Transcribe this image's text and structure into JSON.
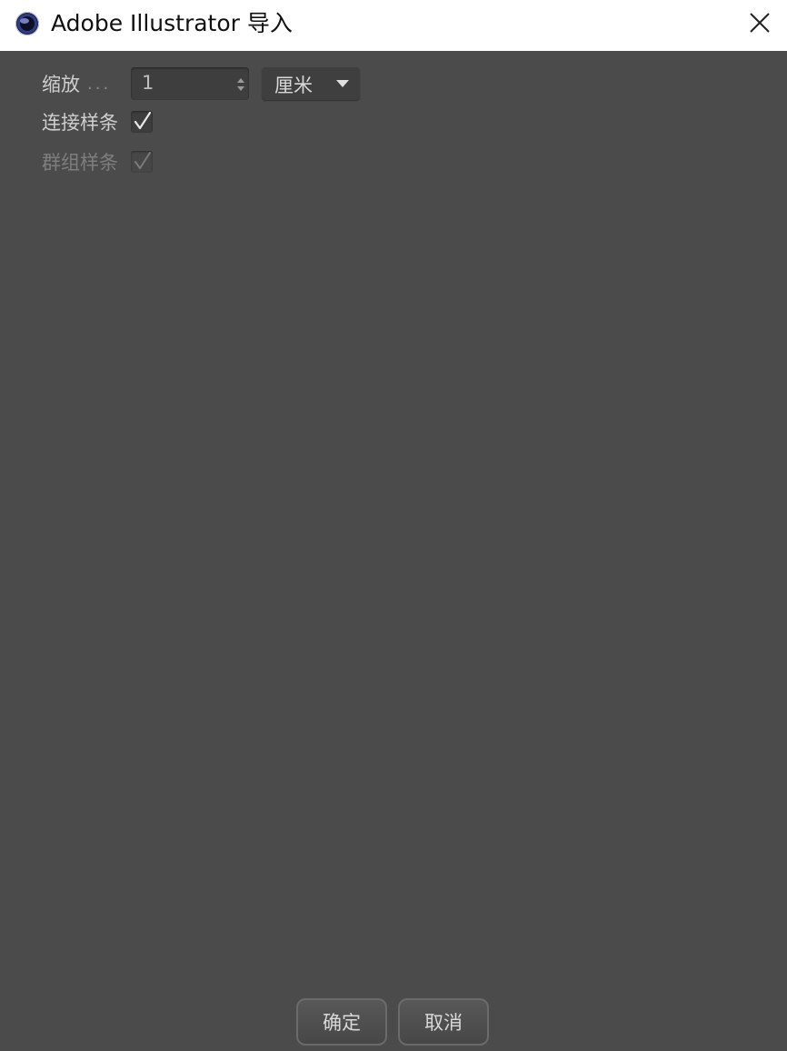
{
  "window": {
    "title": "Adobe Illustrator 导入",
    "app_icon": "cinema4d-logo-icon",
    "close_icon": "close-icon"
  },
  "form": {
    "scale": {
      "label": "缩放",
      "ellipsis": "...",
      "value": "1",
      "unit": "厘米"
    },
    "connect_splines": {
      "label": "连接样条",
      "checked": true
    },
    "group_splines": {
      "label": "群组样条",
      "checked": true,
      "disabled": true
    }
  },
  "buttons": {
    "ok": "确定",
    "cancel": "取消"
  },
  "colors": {
    "background": "#4b4b4b",
    "titlebar": "#ffffff",
    "label": "#cfcfcf",
    "disabled_label": "#7e7e7e"
  }
}
